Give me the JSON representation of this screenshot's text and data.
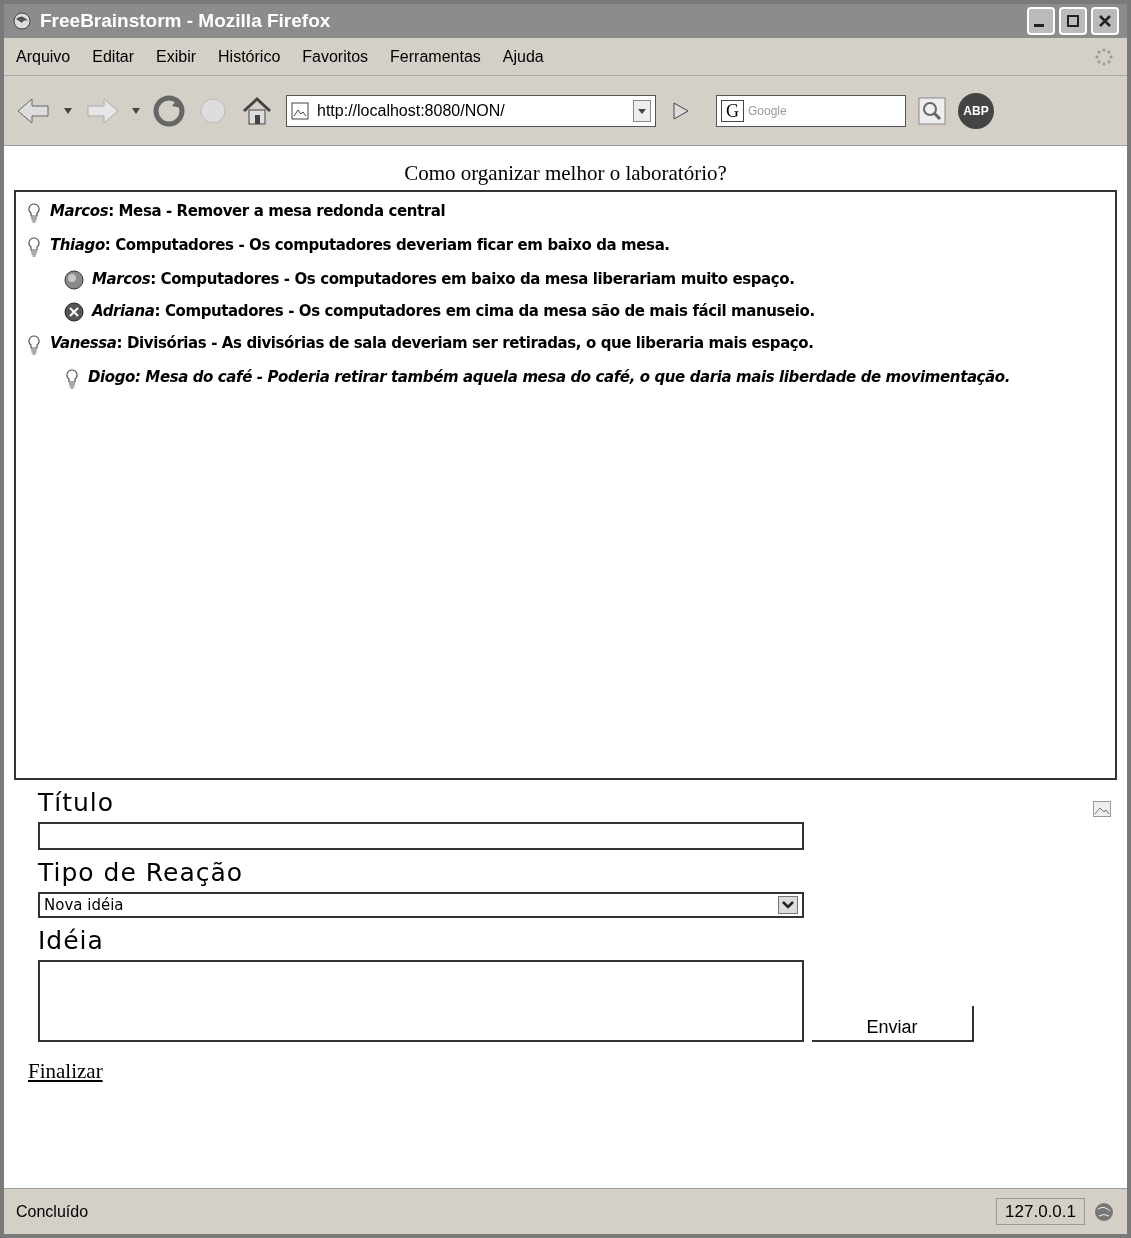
{
  "window": {
    "title": "FreeBrainstorm - Mozilla Firefox"
  },
  "menu": [
    "Arquivo",
    "Editar",
    "Exibir",
    "Histórico",
    "Favoritos",
    "Ferramentas",
    "Ajuda"
  ],
  "toolbar": {
    "address": "http://localhost:8080/NON/",
    "search_placeholder": "Google",
    "search_engine_label": "G",
    "adblock_label": "ABP"
  },
  "page": {
    "heading": "Como organizar melhor o laboratório?",
    "ideas": [
      {
        "kind": "idea",
        "text": "*Marcos*: Mesa - Remover a mesa redonda central",
        "emphasized": false
      },
      {
        "kind": "idea",
        "text": "*Thiago*: Computadores - Os computadores deveriam ficar em baixo da mesa.",
        "emphasized": false,
        "children": [
          {
            "kind": "pro",
            "text": "*Marcos*: Computadores - Os computadores em baixo da mesa liberariam muito espaço.",
            "emphasized": false
          },
          {
            "kind": "con",
            "text": "*Adriana*: Computadores - Os computadores em cima da mesa são de mais fácil manuseio.",
            "emphasized": false
          }
        ]
      },
      {
        "kind": "idea",
        "text": "*Vanessa*: Divisórias - As divisórias de sala deveriam ser retiradas, o que liberaria mais espaço.",
        "emphasized": false,
        "children": [
          {
            "kind": "idea",
            "text": "Diogo: Mesa do café - Poderia retirar também aquela mesa do café, o que daria mais liberdade de movimentação.",
            "emphasized": true
          }
        ]
      }
    ],
    "form": {
      "title_label": "Título",
      "type_label": "Tipo de Reação",
      "type_value": "Nova idéia",
      "idea_label": "Idéia",
      "submit": "Enviar",
      "finish_link": "Finalizar"
    }
  },
  "status_bar": {
    "text": "Concluído",
    "host": "127.0.0.1"
  }
}
